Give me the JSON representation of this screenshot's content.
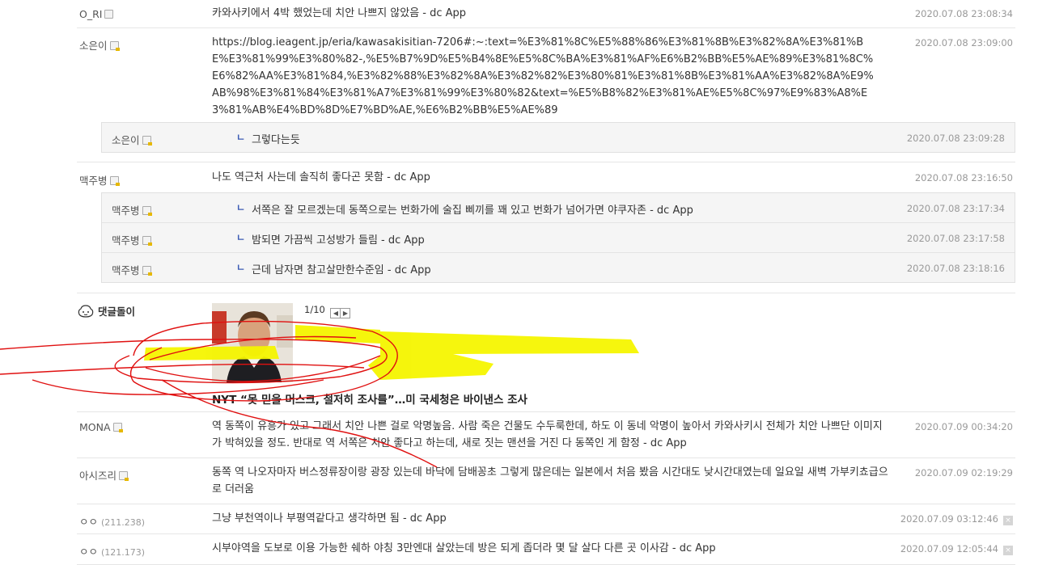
{
  "comments": [
    {
      "name": "O_RI",
      "text": "카와사키에서 4박 했었는데 치안 나쁘지 않았음 - dc App",
      "date": "2020.07.08 23:08:34"
    },
    {
      "name": "소은이",
      "text": "https://blog.ieagent.jp/eria/kawasakisitian-7206#:~:text=%E3%81%8C%E5%88%86%E3%81%8B%E3%82%8A%E3%81%BE%E3%81%99%E3%80%82-,%E5%B7%9D%E5%B4%8E%E5%8C%BA%E3%81%AF%E6%B2%BB%E5%AE%89%E3%81%8C%E6%82%AA%E3%81%84,%E3%82%88%E3%82%8A%E3%82%82%E3%80%81%E3%81%8B%E3%81%AA%E3%82%8A%E9%AB%98%E3%81%84%E3%81%A7%E3%81%99%E3%80%82&text=%E5%B8%82%E3%81%AE%E5%8C%97%E9%83%A8%E3%81%AB%E4%BD%8D%E7%BD%AE,%E6%B2%BB%E5%AE%89",
      "date": "2020.07.08 23:09:00"
    },
    {
      "name": "맥주병",
      "text": "나도 역근처 사는데 솔직히 좋다곤 못함 - dc App",
      "date": "2020.07.08 23:16:50"
    },
    {
      "name": "MONA",
      "text": "역 동쪽이 유흥가 있고 그래서 치안 나쁜 걸로 악명높음. 사람 죽은 건물도 수두룩한데, 하도 이 동네 악명이 높아서 카와사키시 전체가 치안 나쁘단 이미지가 박혀있을 정도. 반대로 역 서쪽은 치안 좋다고 하는데, 새로 짓는 맨션을 거진 다 동쪽인 게 함정 - dc App",
      "date": "2020.07.09 00:34:20"
    },
    {
      "name": "아시즈리",
      "text": "동쪽 역 나오자마자 버스정류장이랑 광장 있는데 바닥에 담배꽁초 그렇게 많은데는 일본에서 처음 봤음 시간대도 낮시간대였는데 일요일 새벽 가부키쵸급으로 더러움",
      "date": "2020.07.09 02:19:29"
    },
    {
      "name": "ㅇㅇ",
      "ip": "(211.238)",
      "text": "그냥 부천역이나 부평역같다고 생각하면 됨 - dc App",
      "date": "2020.07.09 03:12:46"
    },
    {
      "name": "ㅇㅇ",
      "ip": "(121.173)",
      "text": "시부야역을 도보로 이용 가능한 쉐하 야칭 3만엔대 살았는데 방은 되게 좁더라 몇 달 살다 다른 곳 이사감 - dc App",
      "date": "2020.07.09 12:05:44"
    }
  ],
  "replies_a": [
    {
      "name": "소은이",
      "mark": "ㄴ",
      "text": "그렇다는듯",
      "date": "2020.07.08 23:09:28"
    }
  ],
  "replies_b": [
    {
      "name": "맥주병",
      "mark": "ㄴ",
      "text": "서쪽은 잘 모르겠는데 동쪽으로는 번화가에 술집 삐끼를 꽤 있고 번화가 넘어가면 야쿠자존 - dc App",
      "date": "2020.07.08 23:17:34"
    },
    {
      "name": "맥주병",
      "mark": "ㄴ",
      "text": "밤되면 가끔씩 고성방가 들림 - dc App",
      "date": "2020.07.08 23:17:58"
    },
    {
      "name": "맥주병",
      "mark": "ㄴ",
      "text": "근데 남자면 참고살만한수준임 - dc App",
      "date": "2020.07.08 23:18:16"
    }
  ],
  "bot": {
    "label": "댓글돌이",
    "pager": "1/10",
    "prev": "◀",
    "next": "▶",
    "headline": "NYT “못 믿을 머스크, 철저히 조사를”…미 국세청은 바이낸스 조사"
  },
  "delete_glyph": "×",
  "colors": {
    "highlight": "#f5f500",
    "scribble": "#e01010",
    "reply_bg": "#f5f5f5",
    "reply_mark": "#3b5bb5"
  }
}
